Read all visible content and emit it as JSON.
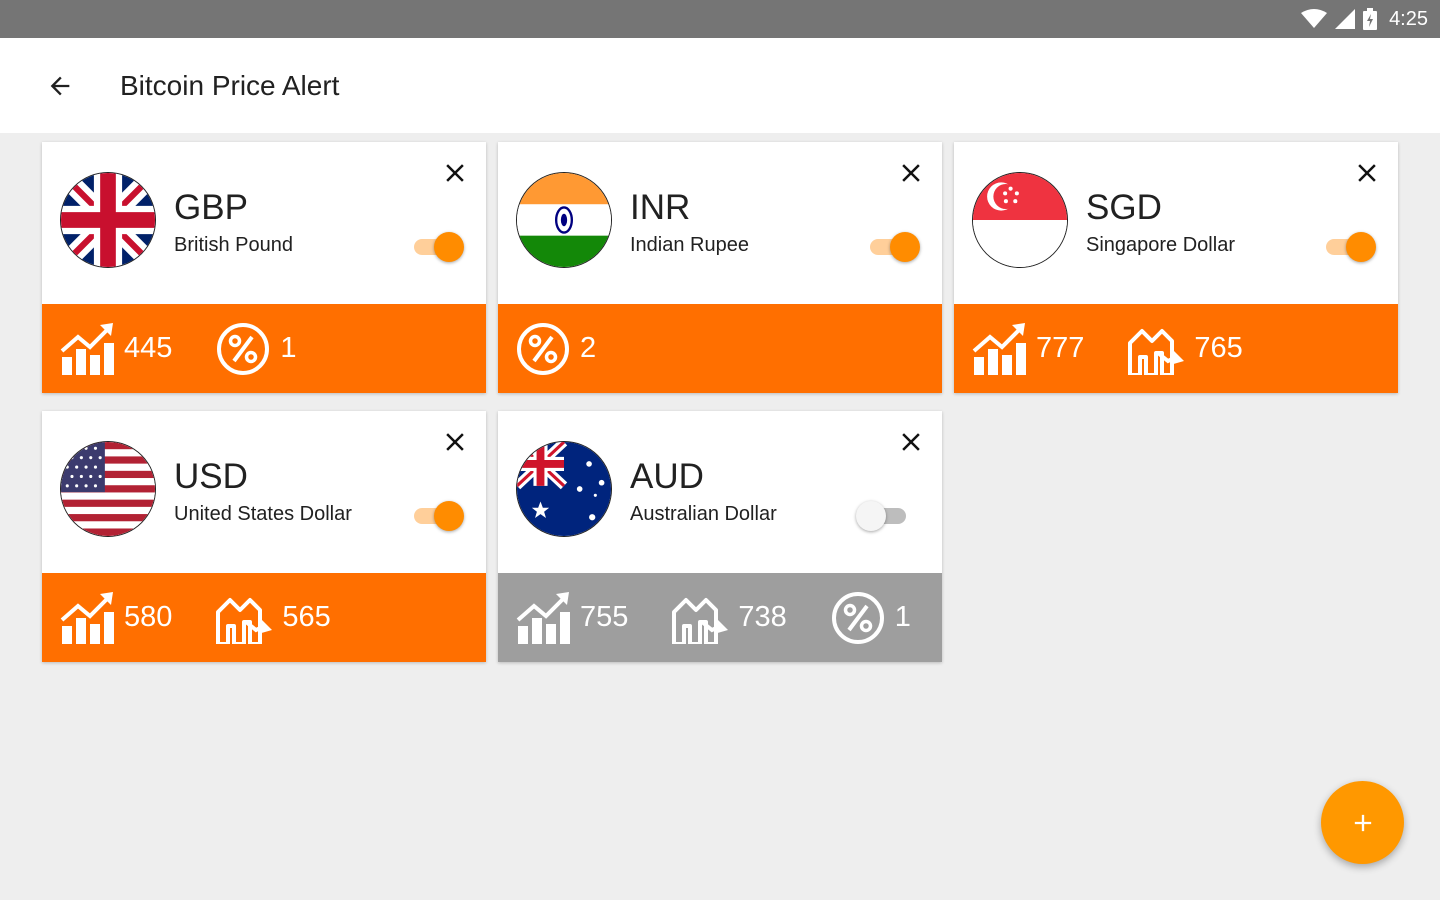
{
  "status_bar": {
    "time": "4:25"
  },
  "app_bar": {
    "title": "Bitcoin Price Alert"
  },
  "cards": [
    {
      "code": "GBP",
      "name": "British Pound",
      "enabled": true,
      "stats": [
        {
          "icon": "rise-icon",
          "value": "445"
        },
        {
          "icon": "percent-icon",
          "value": "1"
        }
      ]
    },
    {
      "code": "INR",
      "name": "Indian Rupee",
      "enabled": true,
      "stats": [
        {
          "icon": "percent-icon",
          "value": "2"
        }
      ]
    },
    {
      "code": "SGD",
      "name": "Singapore Dollar",
      "enabled": true,
      "stats": [
        {
          "icon": "rise-icon",
          "value": "777"
        },
        {
          "icon": "fall-icon",
          "value": "765"
        }
      ]
    },
    {
      "code": "USD",
      "name": "United States Dollar",
      "enabled": true,
      "stats": [
        {
          "icon": "rise-icon",
          "value": "580"
        },
        {
          "icon": "fall-icon",
          "value": "565"
        }
      ]
    },
    {
      "code": "AUD",
      "name": "Australian Dollar",
      "enabled": false,
      "stats": [
        {
          "icon": "rise-icon",
          "value": "755"
        },
        {
          "icon": "fall-icon",
          "value": "738"
        },
        {
          "icon": "percent-icon",
          "value": "1"
        }
      ]
    }
  ],
  "colors": {
    "accent": "#ff6f00",
    "disabled": "#9e9e9e",
    "fab": "#ff9800",
    "toggle_on": "#ff8c00"
  }
}
